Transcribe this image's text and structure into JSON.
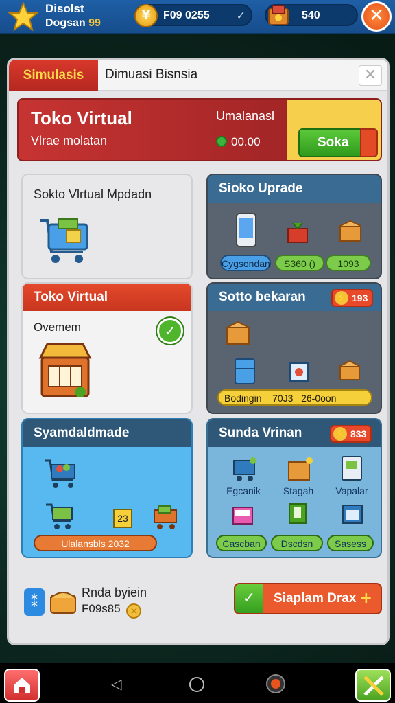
{
  "topbar": {
    "player_name": "Disolst",
    "player_sub": "Dogsan",
    "player_level": "99",
    "coin_symbol": "¥",
    "coins": "F09 0255",
    "gems": "540",
    "close_symbol": "✕"
  },
  "panel": {
    "tab_active": "Simulasis",
    "tab_title": "Dimuasi Bisnsia",
    "tab_close": "✕"
  },
  "banner": {
    "title": "Toko Virtual",
    "subtitle": "Vlrae molatan",
    "label": "Umalanasl",
    "money": "00.00",
    "button": "Soka"
  },
  "cards": {
    "store": {
      "title": "Sokto Vlrtual Mpdadn"
    },
    "upgrade": {
      "title": "Sioko Uprade",
      "pill1": "Cygsondan",
      "pill2": "S360 ()",
      "pill3": "1093"
    },
    "toko": {
      "title": "Toko Virtual",
      "label": "Ovemem",
      "check": "✓"
    },
    "bekaran": {
      "title": "Sotto bekaran",
      "badge": "193",
      "pill": [
        "Bodingin",
        "70J3",
        "26-0oon"
      ]
    },
    "symbol": {
      "title": "Syamdaldmade",
      "tag": "23",
      "pill": "Ulalansbls 2032"
    },
    "sunda": {
      "title": "Sunda Vrinan",
      "badge": "833",
      "items": [
        "Egcanik",
        "Stagah",
        "Vapalar"
      ],
      "pills": [
        "Cascban",
        "Dscdsn",
        "Sasess"
      ]
    }
  },
  "footer": {
    "title": "Rnda byiein",
    "value": "F09s85",
    "button": "Siaplam Drax",
    "plus": "+",
    "check": "✓"
  },
  "nav": {
    "back": "◁"
  },
  "colors": {
    "accent_red": "#c63432",
    "accent_green": "#3cb33c",
    "card_blue_header": "#2f5f86",
    "card_red_header": "#d8402a",
    "pill_yellow": "#f5d03b"
  }
}
